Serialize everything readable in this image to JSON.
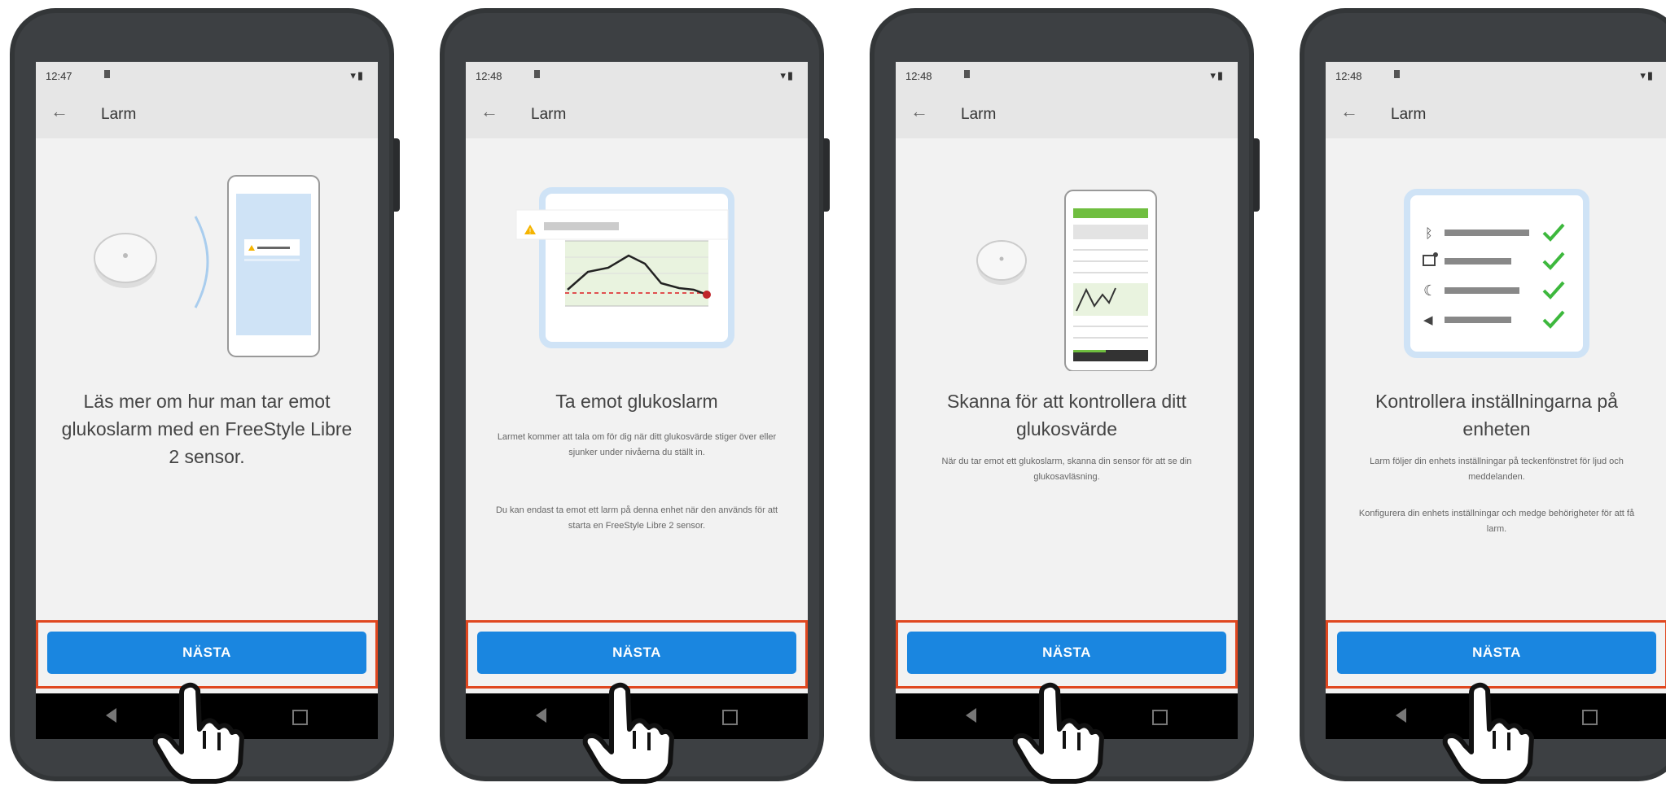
{
  "phones": [
    {
      "time": "12:47",
      "title": "Larm",
      "heading": "Läs mer om hur man tar emot glukoslarm med en FreeStyle Libre 2 sensor.",
      "body": [
        "",
        ""
      ],
      "button": "NÄSTA"
    },
    {
      "time": "12:48",
      "title": "Larm",
      "heading": "Ta emot glukoslarm",
      "body": [
        "Larmet kommer att tala om för dig när ditt glukosvärde stiger över eller sjunker under nivåerna du ställt in.",
        "Du kan endast ta emot ett larm på denna enhet när den används för att starta en FreeStyle Libre 2 sensor."
      ],
      "button": "NÄSTA"
    },
    {
      "time": "12:48",
      "title": "Larm",
      "heading": "Skanna för att kontrollera ditt glukosvärde",
      "body": [
        "När du tar emot ett glukoslarm, skanna din sensor för att se din glukosavläsning.",
        ""
      ],
      "button": "NÄSTA"
    },
    {
      "time": "12:48",
      "title": "Larm",
      "heading": "Kontrollera inställningarna på enheten",
      "body": [
        "Larm följer din enhets inställningar på teckenfönstret för ljud och meddelanden.",
        "Konfigurera din enhets inställningar och medge behörigheter för att få larm."
      ],
      "button": "NÄSTA"
    }
  ],
  "colors": {
    "accent": "#1a86e0",
    "highlight": "#e0471f",
    "check": "#3db83d",
    "warning": "#f5b400"
  },
  "icons": [
    "back-arrow-icon",
    "sim-icon",
    "wifi-icon",
    "battery-icon",
    "nav-back-icon",
    "nav-recents-icon",
    "pointing-hand-icon",
    "warning-icon",
    "bluetooth-icon",
    "notification-icon",
    "moon-icon",
    "speaker-icon",
    "checkmark-icon"
  ]
}
